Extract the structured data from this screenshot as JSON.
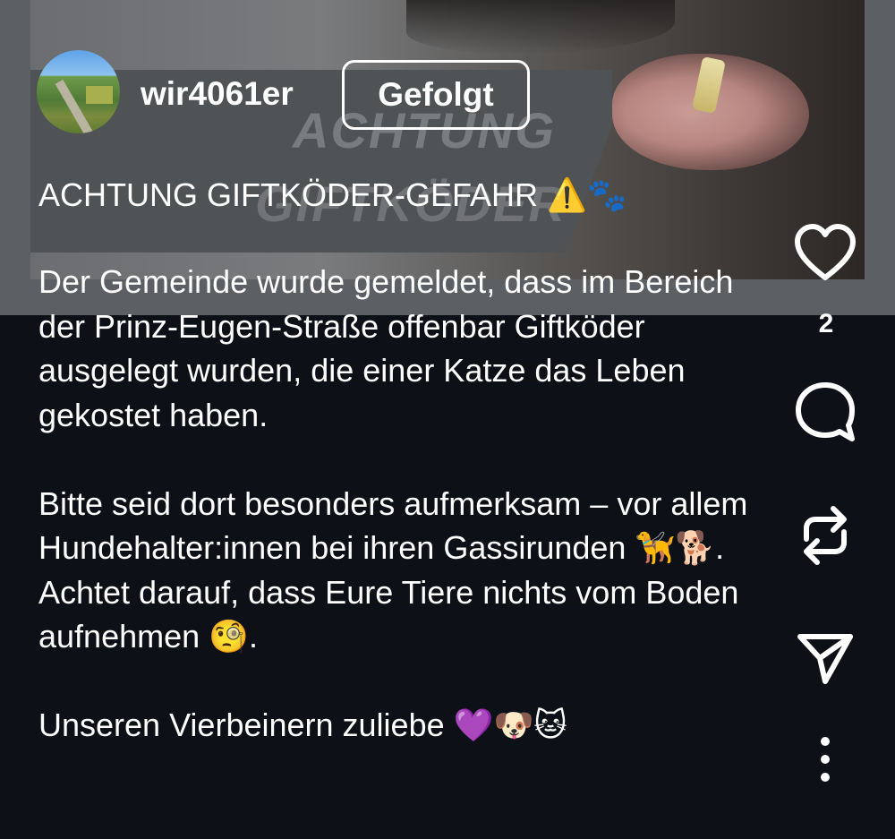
{
  "post": {
    "username": "wir4061er",
    "follow_label": "Gefolgt",
    "image_text_line1": "ACHTUNG",
    "image_text_line2": "GIFTKÖDER",
    "title": "ACHTUNG GIFTKÖDER-GEFAHR ⚠️🐾",
    "body_paragraphs": [
      "Der Gemeinde wurde gemeldet, dass im Bereich der Prinz-Eugen-Straße offenbar Giftköder ausgelegt wurden, die einer Katze das Leben gekostet haben.",
      "Bitte seid dort besonders aufmerksam – vor allem Hundehalter:innen bei ihren Gassirunden 🦮🐕. Achtet darauf, dass Eure Tiere nichts vom Boden aufnehmen 🧐.",
      "Unseren Vierbeinern zuliebe 💜🐶🐱"
    ]
  },
  "actions": {
    "like_icon": "heart-icon",
    "like_count": "2",
    "comment_icon": "comment-icon",
    "repost_icon": "repost-icon",
    "share_icon": "send-icon",
    "more_icon": "more-vertical-icon"
  },
  "colors": {
    "background": "#0d1117",
    "overlay": "#4f5356",
    "text": "#ffffff"
  }
}
